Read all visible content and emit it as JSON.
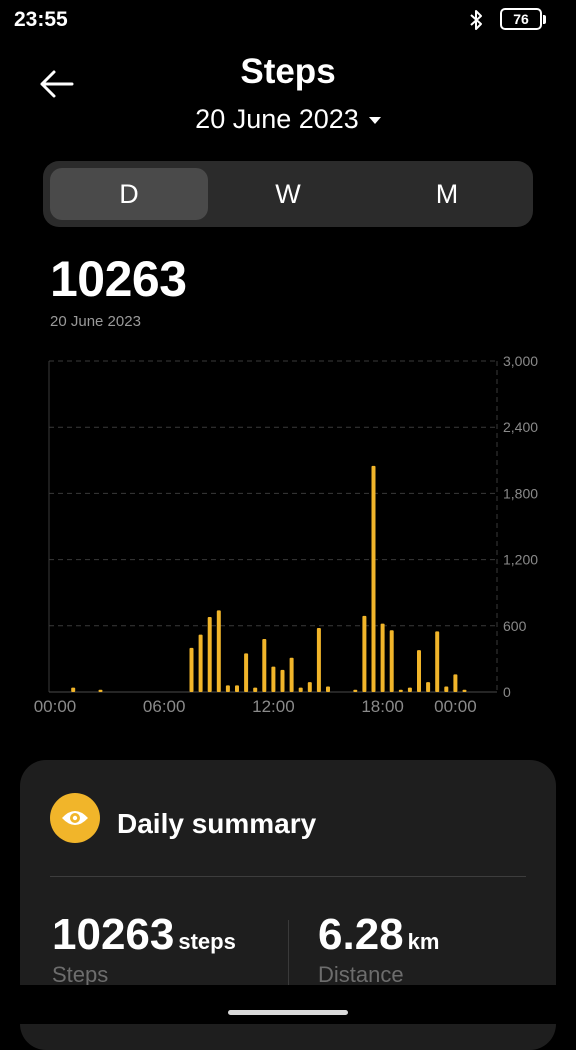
{
  "status_bar": {
    "time": "23:55",
    "battery": "76"
  },
  "header": {
    "title": "Steps",
    "date": "20 June 2023"
  },
  "tabs": [
    {
      "label": "D",
      "active": true
    },
    {
      "label": "W",
      "active": false
    },
    {
      "label": "M",
      "active": false
    }
  ],
  "today": {
    "value": "10263",
    "date": "20 June 2023"
  },
  "chart_data": {
    "type": "bar",
    "ylabel": "",
    "xlabel": "",
    "ylim": [
      0,
      3000
    ],
    "y_ticks": [
      "3,000",
      "2,400",
      "1,800",
      "1,200",
      "600",
      "0"
    ],
    "x_ticks": [
      "00:00",
      "06:00",
      "12:00",
      "18:00",
      "00:00"
    ],
    "x_tick_positions_hours": [
      0,
      6,
      12,
      18,
      22
    ],
    "grid": true,
    "bar_color": "#f1b52a",
    "bars": [
      {
        "hour": 1.0,
        "value": 40
      },
      {
        "hour": 2.5,
        "value": 20
      },
      {
        "hour": 7.5,
        "value": 400
      },
      {
        "hour": 8.0,
        "value": 520
      },
      {
        "hour": 8.5,
        "value": 680
      },
      {
        "hour": 9.0,
        "value": 740
      },
      {
        "hour": 9.5,
        "value": 60
      },
      {
        "hour": 10.0,
        "value": 60
      },
      {
        "hour": 10.5,
        "value": 350
      },
      {
        "hour": 11.0,
        "value": 40
      },
      {
        "hour": 11.5,
        "value": 480
      },
      {
        "hour": 12.0,
        "value": 230
      },
      {
        "hour": 12.5,
        "value": 200
      },
      {
        "hour": 13.0,
        "value": 310
      },
      {
        "hour": 13.5,
        "value": 40
      },
      {
        "hour": 14.0,
        "value": 90
      },
      {
        "hour": 14.5,
        "value": 580
      },
      {
        "hour": 15.0,
        "value": 50
      },
      {
        "hour": 16.5,
        "value": 20
      },
      {
        "hour": 17.0,
        "value": 690
      },
      {
        "hour": 17.5,
        "value": 2050
      },
      {
        "hour": 18.0,
        "value": 620
      },
      {
        "hour": 18.5,
        "value": 560
      },
      {
        "hour": 19.0,
        "value": 20
      },
      {
        "hour": 19.5,
        "value": 40
      },
      {
        "hour": 20.0,
        "value": 380
      },
      {
        "hour": 20.5,
        "value": 90
      },
      {
        "hour": 21.0,
        "value": 550
      },
      {
        "hour": 21.5,
        "value": 50
      },
      {
        "hour": 22.0,
        "value": 160
      },
      {
        "hour": 22.5,
        "value": 20
      }
    ]
  },
  "summary": {
    "title": "Daily summary",
    "icon": "eye-icon",
    "steps": {
      "value": "10263",
      "unit": "steps",
      "label": "Steps"
    },
    "distance": {
      "value": "6.28",
      "unit": "km",
      "label": "Distance"
    }
  }
}
